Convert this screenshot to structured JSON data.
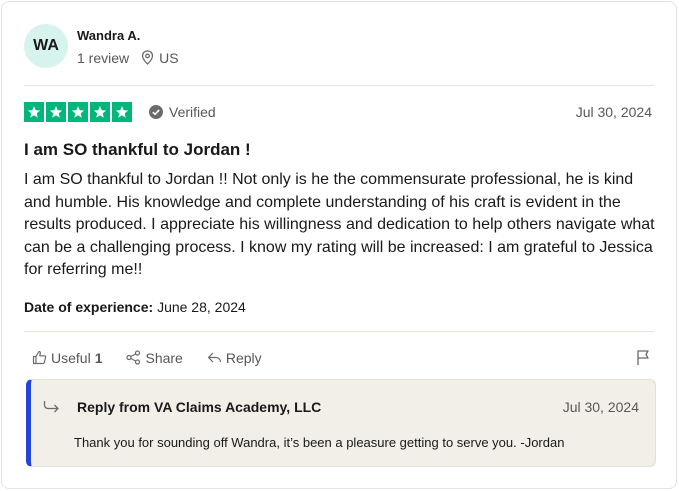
{
  "reviewer": {
    "initials": "WA",
    "name": "Wandra A.",
    "review_count": "1 review",
    "country": "US"
  },
  "review": {
    "rating": 5,
    "max_rating": 5,
    "verified_label": "Verified",
    "date": "Jul 30, 2024",
    "title": "I am SO thankful to Jordan !",
    "body": "I am SO thankful to Jordan !! Not only is he the commensurate professional, he is kind and humble. His knowledge and complete understanding of his craft is evident in the results produced. I appreciate his willingness and dedication to help others navigate what can be a challenging process. I know my rating will be increased: I am grateful to Jessica for referring me!!",
    "experience_label": "Date of experience:",
    "experience_date": "June 28, 2024"
  },
  "actions": {
    "useful_label": "Useful",
    "useful_count": "1",
    "share_label": "Share",
    "reply_label": "Reply"
  },
  "reply": {
    "from": "Reply from VA Claims Academy, LLC",
    "date": "Jul 30, 2024",
    "text": "Thank you for sounding off Wandra, it’s been a pleasure getting to serve you. -Jordan"
  },
  "colors": {
    "star_green": "#00b67a",
    "reply_accent": "#2445d3",
    "avatar_bg": "#d7f3ee"
  },
  "icons": [
    "location-pin-icon",
    "star-icon",
    "verified-check-icon",
    "thumbs-up-icon",
    "share-icon",
    "reply-arrow-icon",
    "flag-icon",
    "reply-indent-icon"
  ]
}
